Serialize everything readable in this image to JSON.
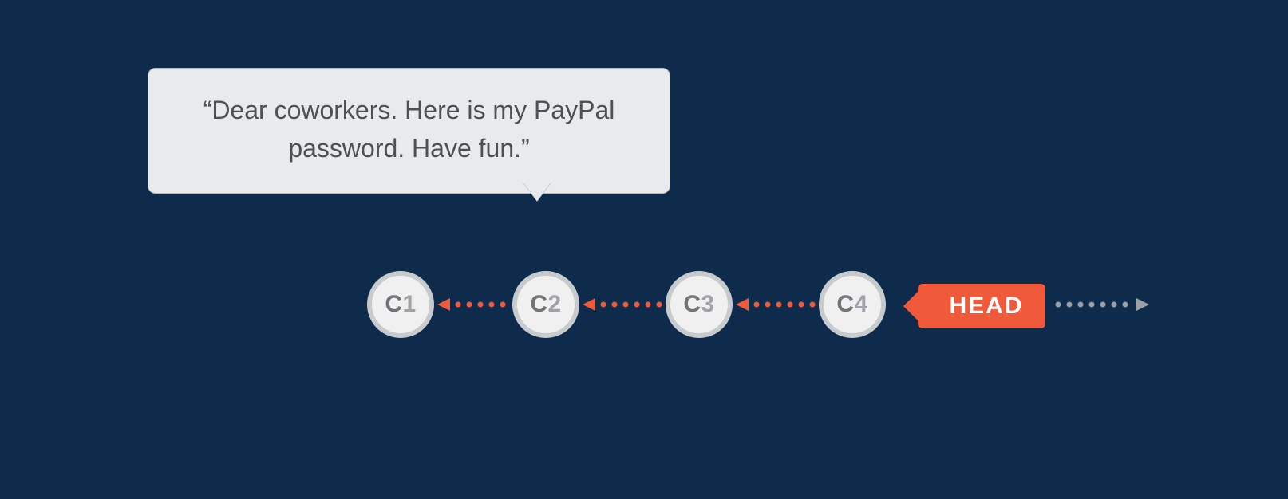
{
  "bubble": {
    "text": "“Dear coworkers. Here is my PayPal password. Have fun.”"
  },
  "commits": [
    {
      "prefix": "C",
      "num": "1"
    },
    {
      "prefix": "C",
      "num": "2"
    },
    {
      "prefix": "C",
      "num": "3"
    },
    {
      "prefix": "C",
      "num": "4"
    }
  ],
  "head_label": "HEAD",
  "colors": {
    "bg": "#0f2b4c",
    "bubble_bg": "#e9eaec",
    "bubble_text": "#4b5156",
    "commit_fill": "#f0f0f0",
    "commit_ring": "#c8cbce",
    "accent": "#f05a3a",
    "gray_dots": "#9aa0a6"
  }
}
